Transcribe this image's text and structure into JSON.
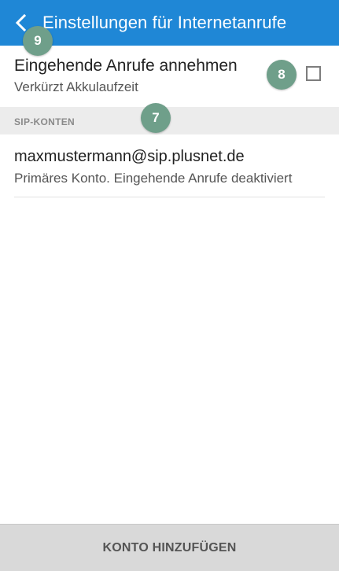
{
  "appbar": {
    "title": "Einstellungen für Internetanrufe",
    "background": "#1f87d6",
    "back_icon": "chevron-left-icon"
  },
  "incoming": {
    "title": "Eingehende Anrufe annehmen",
    "subtitle": "Verkürzt Akkulaufzeit",
    "checked": false
  },
  "section": {
    "title": "SIP-KONTEN"
  },
  "account": {
    "address": "maxmustermann@sip.plusnet.de",
    "status": "Primäres Konto. Eingehende Anrufe deaktiviert"
  },
  "footer": {
    "button_label": "KONTO HINZUFÜGEN"
  },
  "badges": {
    "nine": "9",
    "eight": "8",
    "seven": "7",
    "color": "#6f9f8a"
  }
}
